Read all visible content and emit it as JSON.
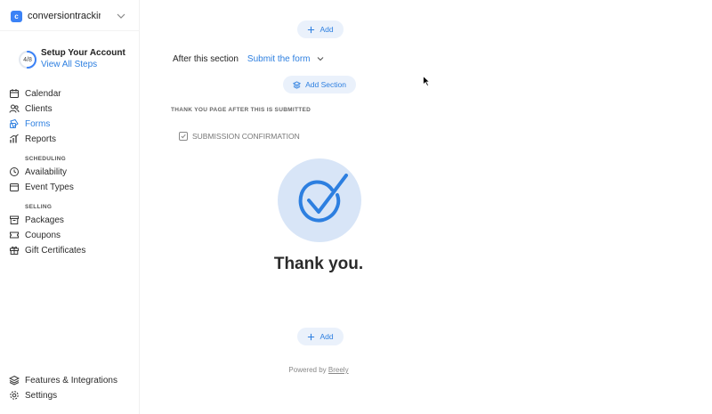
{
  "workspace": {
    "badge": "c",
    "name": "conversiontrackin..."
  },
  "setup": {
    "progress": "4/8",
    "progress_fraction": 0.5,
    "title": "Setup Your Account",
    "link": "View All Steps"
  },
  "nav": {
    "main": [
      {
        "label": "Calendar",
        "icon": "calendar-icon",
        "active": false
      },
      {
        "label": "Clients",
        "icon": "users-icon",
        "active": false
      },
      {
        "label": "Forms",
        "icon": "forms-icon",
        "active": true
      },
      {
        "label": "Reports",
        "icon": "chart-icon",
        "active": false
      }
    ],
    "scheduling_heading": "SCHEDULING",
    "scheduling": [
      {
        "label": "Availability",
        "icon": "clock-icon"
      },
      {
        "label": "Event Types",
        "icon": "event-icon"
      }
    ],
    "selling_heading": "SELLING",
    "selling": [
      {
        "label": "Packages",
        "icon": "package-icon"
      },
      {
        "label": "Coupons",
        "icon": "coupon-icon"
      },
      {
        "label": "Gift Certificates",
        "icon": "gift-icon"
      }
    ],
    "bottom": [
      {
        "label": "Features & Integrations",
        "icon": "layers-icon"
      },
      {
        "label": "Settings",
        "icon": "gear-icon"
      }
    ]
  },
  "main": {
    "add_top_label": "Add",
    "after_section_label": "After this section",
    "after_section_value": "Submit the form",
    "add_section_label": "Add Section",
    "thank_you_heading": "THANK YOU PAGE AFTER THIS IS SUBMITTED",
    "confirmation_label": "SUBMISSION CONFIRMATION",
    "thanks_text": "Thank you.",
    "add_bottom_label": "Add",
    "powered_prefix": "Powered by",
    "powered_brand": "Breely"
  },
  "colors": {
    "accent": "#2d7fe0",
    "pill_bg": "#eaf1fb",
    "check_bg": "#d8e5f7"
  }
}
